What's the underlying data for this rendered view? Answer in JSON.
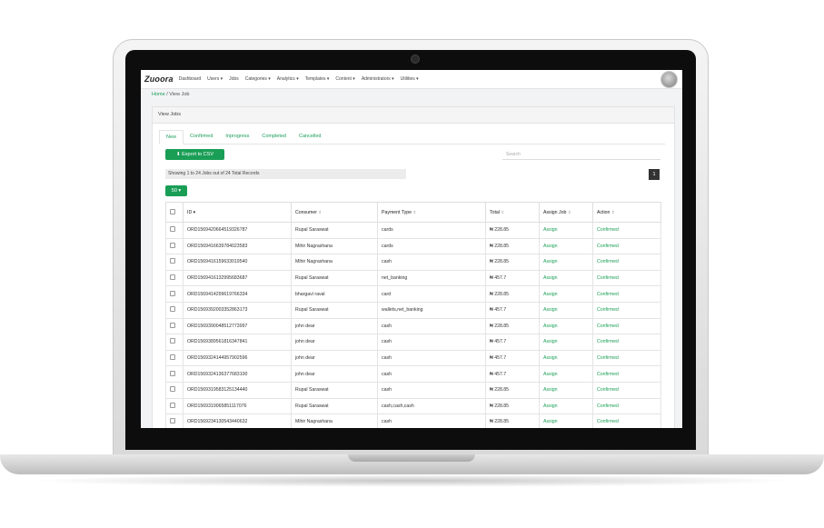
{
  "topnav": {
    "brand": "Zuoora",
    "items": [
      "Dashboard",
      "Users ▾",
      "Jobs",
      "Categories ▾",
      "Analytics ▾",
      "Templates ▾",
      "Content ▾",
      "Administrators ▾",
      "Utilities ▾"
    ]
  },
  "breadcrumb": {
    "home": "Home",
    "sep": "/",
    "current": "View Job"
  },
  "panel": {
    "title": "View Jobs"
  },
  "tabs": [
    "New",
    "Confirmed",
    "Inprogress",
    "Completed",
    "Cancelled"
  ],
  "toolbar": {
    "export_label": "Export to CSV",
    "search_placeholder": "Search",
    "showing": "Showing 1 to 24 Jobs out of 24 Total Records",
    "page": "1",
    "page_size": "50"
  },
  "table": {
    "headers": [
      "ID",
      "Consumer",
      "Payment Type",
      "Total",
      "Assign Job",
      "Action"
    ],
    "rows": [
      [
        "ORD1569420664519326787",
        "Rupal Saraswat",
        "cards",
        "₦ 228.85",
        "Assign",
        "Confirmed"
      ],
      [
        "ORD1569416639784023583",
        "Mihir Nagrashana",
        "cards",
        "₦ 228.85",
        "Assign",
        "Confirmed"
      ],
      [
        "ORD1569416159633019540",
        "Mihir Nagrashana",
        "cash",
        "₦ 228.85",
        "Assign",
        "Confirmed"
      ],
      [
        "ORD1569416132995683687",
        "Rupal Saraswat",
        "net_banking",
        "₦ 457.7",
        "Assign",
        "Confirmed"
      ],
      [
        "ORD1569414299619766334",
        "bhargavi raval",
        "card",
        "₦ 228.85",
        "Assign",
        "Confirmed"
      ],
      [
        "ORD1569392003352863173",
        "Rupal Saraswat",
        "wallets,net_banking",
        "₦ 457.7",
        "Assign",
        "Confirmed"
      ],
      [
        "ORD1569390048512773997",
        "john dear",
        "cash",
        "₦ 228.85",
        "Assign",
        "Confirmed"
      ],
      [
        "ORD1569389561816347841",
        "john dear",
        "cash",
        "₦ 457.7",
        "Assign",
        "Confirmed"
      ],
      [
        "ORD1569324144957902596",
        "john dear",
        "cash",
        "₦ 457.7",
        "Assign",
        "Confirmed"
      ],
      [
        "ORD1569324136377683100",
        "john dear",
        "cash",
        "₦ 457.7",
        "Assign",
        "Confirmed"
      ],
      [
        "ORD1569319583125134440",
        "Rupal Saraswat",
        "cash",
        "₦ 228.85",
        "Assign",
        "Confirmed"
      ],
      [
        "ORD1569319065851117076",
        "Rupal Saraswat",
        "cash,cash,cash",
        "₦ 228.85",
        "Assign",
        "Confirmed"
      ],
      [
        "ORD1569234130543440632",
        "Mihir Nagrashana",
        "cash",
        "₦ 228.85",
        "Assign",
        "Confirmed"
      ]
    ]
  }
}
